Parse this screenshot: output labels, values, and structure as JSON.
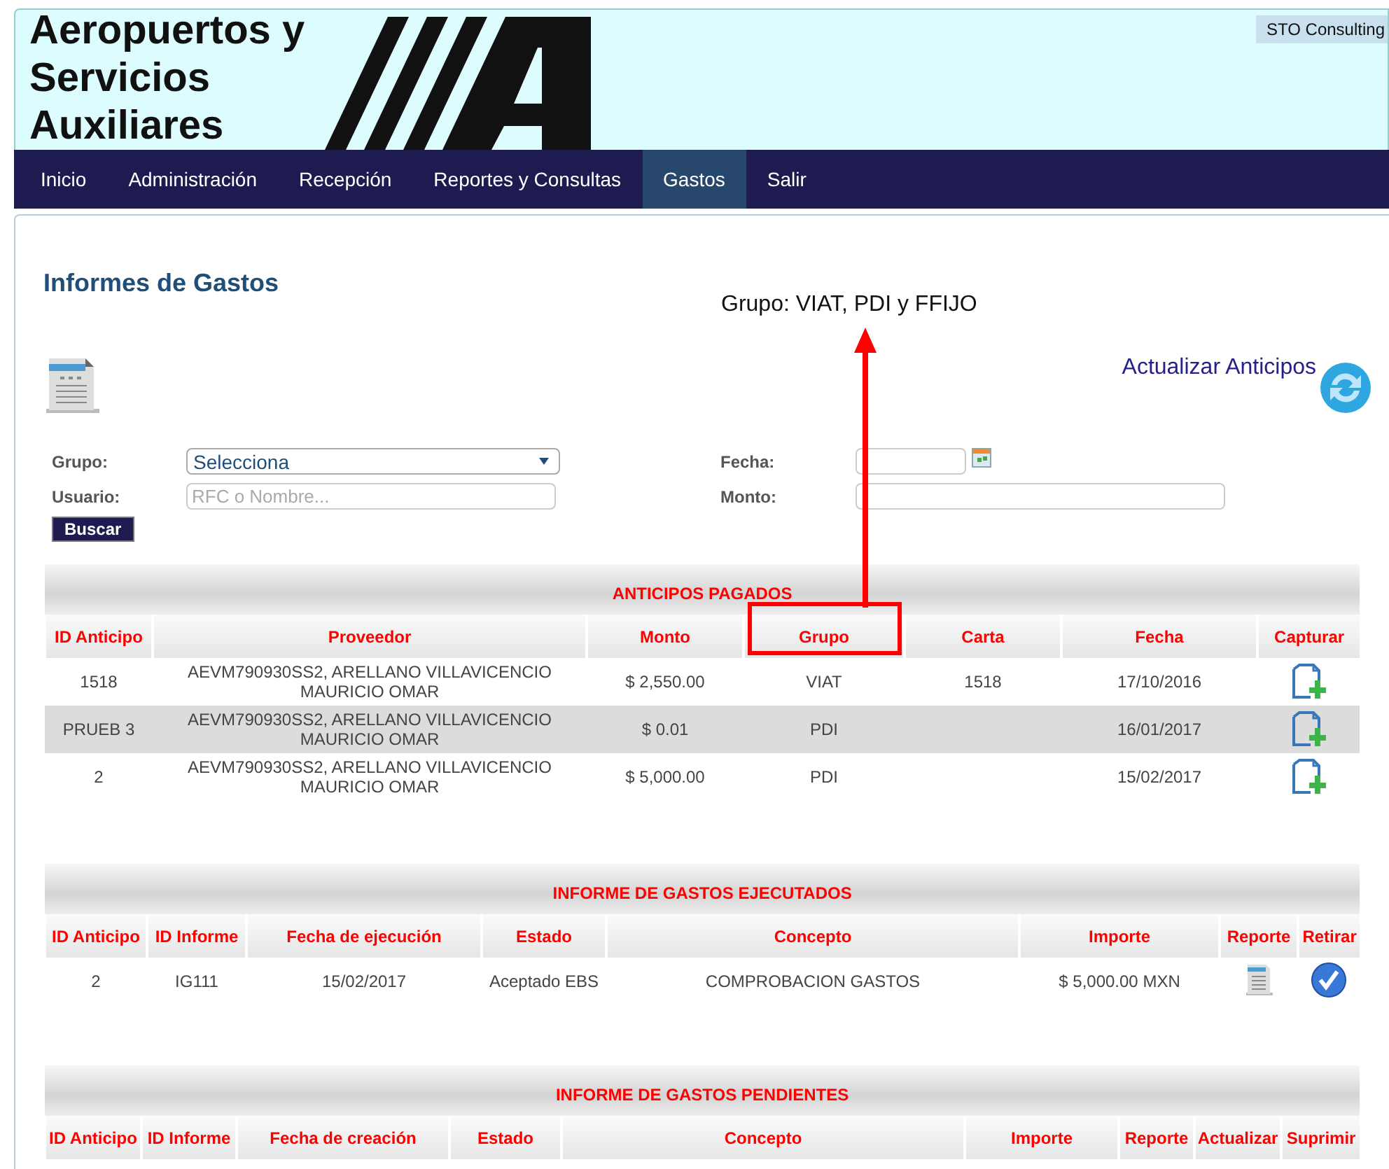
{
  "header": {
    "logo_lines": [
      "Aeropuertos y",
      "Servicios",
      "Auxiliares"
    ],
    "company": "STO Consulting"
  },
  "nav": [
    {
      "label": "Inicio",
      "selected": false
    },
    {
      "label": "Administración",
      "selected": false
    },
    {
      "label": "Recepción",
      "selected": false
    },
    {
      "label": "Reportes y Consultas",
      "selected": false
    },
    {
      "label": "Gastos",
      "selected": true
    },
    {
      "label": "Salir",
      "selected": false
    }
  ],
  "page_title": "Informes de Gastos",
  "annotation": {
    "label": "Grupo: VIAT, PDI y FFIJO"
  },
  "refresh_link": "Actualizar Anticipos",
  "filters": {
    "grupo": {
      "label": "Grupo:",
      "value": "Selecciona"
    },
    "usuario": {
      "label": "Usuario:",
      "placeholder": "RFC o Nombre..."
    },
    "fecha": {
      "label": "Fecha:"
    },
    "monto": {
      "label": "Monto:"
    },
    "search_button": "Buscar"
  },
  "anticipos": {
    "title": "ANTICIPOS PAGADOS",
    "columns": [
      "ID Anticipo",
      "Proveedor",
      "Monto",
      "Grupo",
      "Carta",
      "Fecha",
      "Capturar"
    ],
    "rows": [
      {
        "id": "1518",
        "proveedor": "AEVM790930SS2, ARELLANO VILLAVICENCIO MAURICIO OMAR",
        "monto": "$ 2,550.00",
        "grupo": "VIAT",
        "carta": "1518",
        "fecha": "17/10/2016"
      },
      {
        "id": "PRUEB 3",
        "proveedor": "AEVM790930SS2, ARELLANO VILLAVICENCIO MAURICIO OMAR",
        "monto": "$ 0.01",
        "grupo": "PDI",
        "fecha": "16/01/2017"
      },
      {
        "id": "2",
        "proveedor": "AEVM790930SS2, ARELLANO VILLAVICENCIO MAURICIO OMAR",
        "monto": "$ 5,000.00",
        "grupo": "PDI",
        "fecha": "15/02/2017"
      }
    ]
  },
  "ejecutados": {
    "title": "INFORME DE GASTOS EJECUTADOS",
    "columns": [
      "ID Anticipo",
      "ID Informe",
      "Fecha de ejecución",
      "Estado",
      "Concepto",
      "Importe",
      "Reporte",
      "Retirar"
    ],
    "rows": [
      {
        "id": "2",
        "informe": "IG111",
        "fecha": "15/02/2017",
        "estado": "Aceptado EBS",
        "concepto": "COMPROBACION GASTOS",
        "importe": "$ 5,000.00 MXN"
      }
    ]
  },
  "pendientes": {
    "title": "INFORME DE GASTOS PENDIENTES",
    "columns": [
      "ID Anticipo",
      "ID Informe",
      "Fecha de creación",
      "Estado",
      "Concepto",
      "Importe",
      "Reporte",
      "Actualizar",
      "Suprimir"
    ]
  }
}
